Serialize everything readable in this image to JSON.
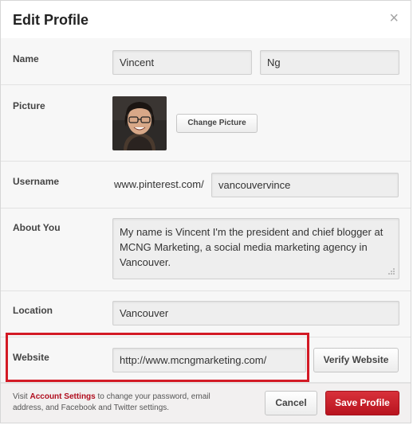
{
  "dialog": {
    "title": "Edit Profile",
    "close_glyph": "×"
  },
  "name": {
    "label": "Name",
    "first": "Vincent",
    "last": "Ng"
  },
  "picture": {
    "label": "Picture",
    "change_button": "Change Picture"
  },
  "username": {
    "label": "Username",
    "prefix": "www.pinterest.com/",
    "value": "vancouvervince"
  },
  "about": {
    "label": "About You",
    "value": "My name is Vincent I'm the president and chief blogger at MCNG Marketing, a social media marketing agency in Vancouver."
  },
  "location": {
    "label": "Location",
    "value": "Vancouver"
  },
  "website": {
    "label": "Website",
    "value": "http://www.mcngmarketing.com/",
    "verify_button": "Verify Website"
  },
  "footer": {
    "text_before": "Visit ",
    "link": "Account Settings",
    "text_after": " to change your password, email address, and Facebook and Twitter settings.",
    "cancel_button": "Cancel",
    "save_button": "Save Profile"
  },
  "colors": {
    "accent_red": "#c41f2b",
    "highlight_red": "#d31a25"
  }
}
